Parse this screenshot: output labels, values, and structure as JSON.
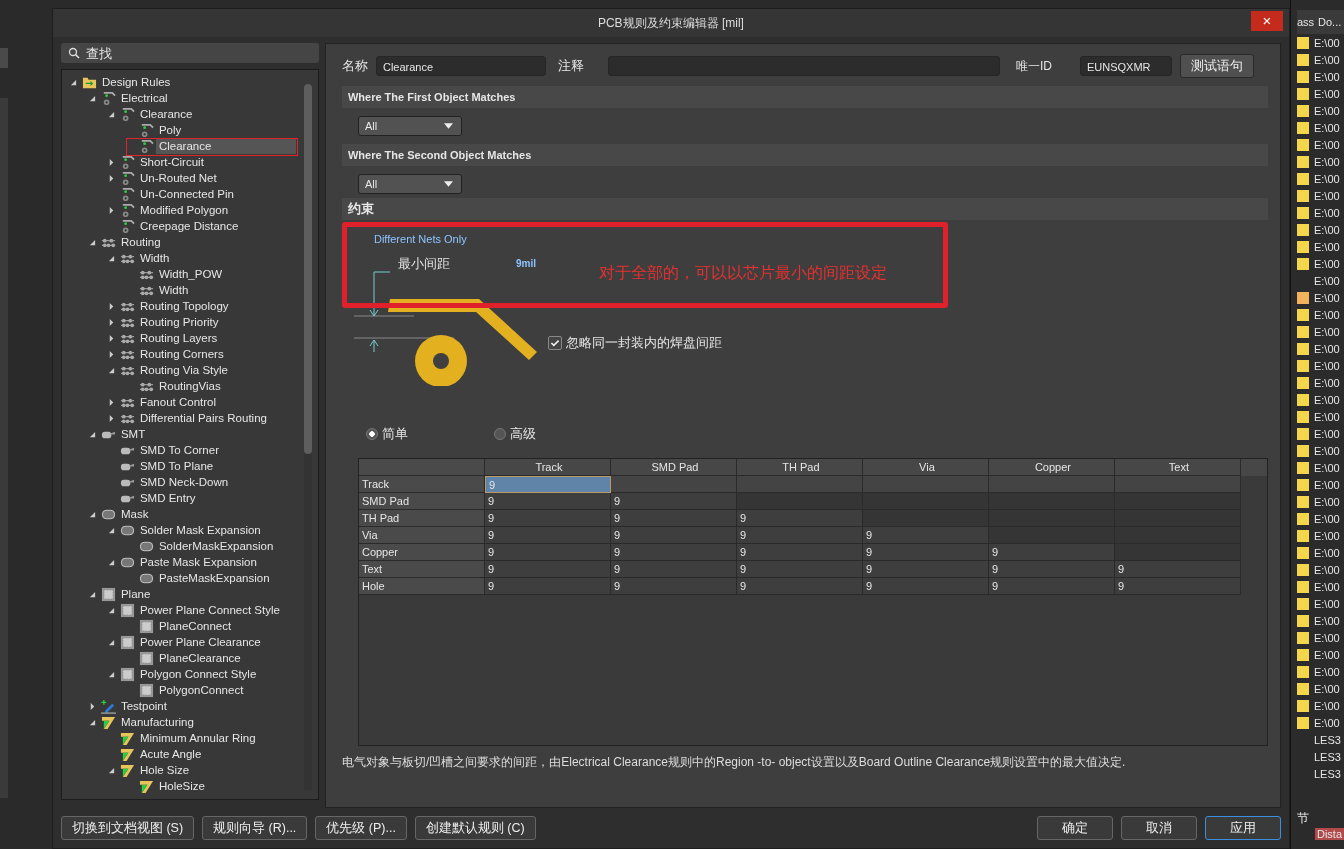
{
  "window": {
    "title": "PCB规则及约束编辑器 [mil]",
    "close": "×"
  },
  "search": {
    "placeholder": "查找"
  },
  "tree": [
    {
      "label": "Design Rules",
      "kind": "rules",
      "expanded": true,
      "selected": false,
      "children": [
        {
          "label": "Electrical",
          "kind": "electrical",
          "expanded": true,
          "selected": false,
          "children": [
            {
              "label": "Clearance",
              "kind": "electrical",
              "expanded": true,
              "selected": false,
              "children": [
                {
                  "label": "Poly",
                  "kind": "electrical",
                  "selected": false
                },
                {
                  "label": "Clearance",
                  "kind": "electrical",
                  "selected": true
                }
              ]
            },
            {
              "label": "Short-Circuit",
              "kind": "electrical",
              "expanded": false,
              "selected": false
            },
            {
              "label": "Un-Routed Net",
              "kind": "electrical",
              "expanded": false,
              "selected": false
            },
            {
              "label": "Un-Connected Pin",
              "kind": "electrical",
              "selected": false
            },
            {
              "label": "Modified Polygon",
              "kind": "electrical",
              "expanded": false,
              "selected": false
            },
            {
              "label": "Creepage Distance",
              "kind": "electrical",
              "selected": false
            }
          ]
        },
        {
          "label": "Routing",
          "kind": "routing",
          "expanded": true,
          "selected": false,
          "children": [
            {
              "label": "Width",
              "kind": "routing",
              "expanded": true,
              "selected": false,
              "children": [
                {
                  "label": "Width_POW",
                  "kind": "routing",
                  "selected": false
                },
                {
                  "label": "Width",
                  "kind": "routing",
                  "selected": false
                }
              ]
            },
            {
              "label": "Routing Topology",
              "kind": "routing",
              "expanded": false,
              "selected": false
            },
            {
              "label": "Routing Priority",
              "kind": "routing",
              "expanded": false,
              "selected": false
            },
            {
              "label": "Routing Layers",
              "kind": "routing",
              "expanded": false,
              "selected": false
            },
            {
              "label": "Routing Corners",
              "kind": "routing",
              "expanded": false,
              "selected": false
            },
            {
              "label": "Routing Via Style",
              "kind": "routing",
              "expanded": true,
              "selected": false,
              "children": [
                {
                  "label": "RoutingVias",
                  "kind": "routing",
                  "selected": false
                }
              ]
            },
            {
              "label": "Fanout Control",
              "kind": "routing",
              "expanded": false,
              "selected": false
            },
            {
              "label": "Differential Pairs Routing",
              "kind": "routing",
              "expanded": false,
              "selected": false
            }
          ]
        },
        {
          "label": "SMT",
          "kind": "smt",
          "expanded": true,
          "selected": false,
          "children": [
            {
              "label": "SMD To Corner",
              "kind": "smt",
              "selected": false
            },
            {
              "label": "SMD To Plane",
              "kind": "smt",
              "selected": false
            },
            {
              "label": "SMD Neck-Down",
              "kind": "smt",
              "selected": false
            },
            {
              "label": "SMD Entry",
              "kind": "smt",
              "selected": false
            }
          ]
        },
        {
          "label": "Mask",
          "kind": "mask",
          "expanded": true,
          "selected": false,
          "children": [
            {
              "label": "Solder Mask Expansion",
              "kind": "mask",
              "expanded": true,
              "selected": false,
              "children": [
                {
                  "label": "SolderMaskExpansion",
                  "kind": "mask",
                  "selected": false
                }
              ]
            },
            {
              "label": "Paste Mask Expansion",
              "kind": "mask",
              "expanded": true,
              "selected": false,
              "children": [
                {
                  "label": "PasteMaskExpansion",
                  "kind": "mask",
                  "selected": false
                }
              ]
            }
          ]
        },
        {
          "label": "Plane",
          "kind": "plane",
          "expanded": true,
          "selected": false,
          "children": [
            {
              "label": "Power Plane Connect Style",
              "kind": "plane",
              "expanded": true,
              "selected": false,
              "children": [
                {
                  "label": "PlaneConnect",
                  "kind": "plane",
                  "selected": false
                }
              ]
            },
            {
              "label": "Power Plane Clearance",
              "kind": "plane",
              "expanded": true,
              "selected": false,
              "children": [
                {
                  "label": "PlaneClearance",
                  "kind": "plane",
                  "selected": false
                }
              ]
            },
            {
              "label": "Polygon Connect Style",
              "kind": "plane",
              "expanded": true,
              "selected": false,
              "children": [
                {
                  "label": "PolygonConnect",
                  "kind": "plane",
                  "selected": false
                }
              ]
            }
          ]
        },
        {
          "label": "Testpoint",
          "kind": "testpoint",
          "expanded": false,
          "selected": false
        },
        {
          "label": "Manufacturing",
          "kind": "manufacturing",
          "expanded": true,
          "selected": false,
          "children": [
            {
              "label": "Minimum Annular Ring",
              "kind": "manufacturing",
              "selected": false
            },
            {
              "label": "Acute Angle",
              "kind": "manufacturing",
              "selected": false
            },
            {
              "label": "Hole Size",
              "kind": "manufacturing",
              "expanded": true,
              "selected": false,
              "children": [
                {
                  "label": "HoleSize",
                  "kind": "manufacturing",
                  "selected": false
                }
              ]
            }
          ]
        }
      ]
    }
  ],
  "rule": {
    "name_label": "名称",
    "name": "Clearance",
    "comment_label": "注释",
    "id_label": "唯一ID",
    "id": "EUNSQXMR",
    "test_button": "测试语句"
  },
  "first_match": {
    "title": "Where The First Object Matches",
    "value": "All"
  },
  "second_match": {
    "title": "Where The Second Object Matches",
    "value": "All"
  },
  "constraints": {
    "title": "约束",
    "scope": "Different Nets Only",
    "min_label": "最小间距",
    "min_value": "9mil",
    "annotation": "对于全部的，可以以芯片最小的间距设定",
    "ignore_pads": {
      "label": "忽略同一封装内的焊盘间距",
      "checked": true
    },
    "modes": [
      {
        "label": "简单",
        "selected": true
      },
      {
        "label": "高级",
        "selected": false
      }
    ]
  },
  "table": {
    "columns": [
      "Track",
      "SMD Pad",
      "TH Pad",
      "Via",
      "Copper",
      "Text"
    ],
    "rows": [
      {
        "label": "Track",
        "cells": [
          {
            "value": "9",
            "selected": true
          }
        ]
      },
      {
        "label": "SMD Pad",
        "cells": [
          {
            "value": "9",
            "selected": false
          },
          {
            "value": "9",
            "selected": false
          }
        ]
      },
      {
        "label": "TH Pad",
        "cells": [
          {
            "value": "9",
            "selected": false
          },
          {
            "value": "9",
            "selected": false
          },
          {
            "value": "9",
            "selected": false
          }
        ]
      },
      {
        "label": "Via",
        "cells": [
          {
            "value": "9",
            "selected": false
          },
          {
            "value": "9",
            "selected": false
          },
          {
            "value": "9",
            "selected": false
          },
          {
            "value": "9",
            "selected": false
          }
        ]
      },
      {
        "label": "Copper",
        "cells": [
          {
            "value": "9",
            "selected": false
          },
          {
            "value": "9",
            "selected": false
          },
          {
            "value": "9",
            "selected": false
          },
          {
            "value": "9",
            "selected": false
          },
          {
            "value": "9",
            "selected": false
          }
        ]
      },
      {
        "label": "Text",
        "cells": [
          {
            "value": "9",
            "selected": false
          },
          {
            "value": "9",
            "selected": false
          },
          {
            "value": "9",
            "selected": false
          },
          {
            "value": "9",
            "selected": false
          },
          {
            "value": "9",
            "selected": false
          },
          {
            "value": "9",
            "selected": false
          }
        ]
      },
      {
        "label": "Hole",
        "cells": [
          {
            "value": "9",
            "selected": false
          },
          {
            "value": "9",
            "selected": false
          },
          {
            "value": "9",
            "selected": false
          },
          {
            "value": "9",
            "selected": false
          },
          {
            "value": "9",
            "selected": false
          },
          {
            "value": "9",
            "selected": false
          }
        ]
      }
    ]
  },
  "note": "电气对象与板切/凹槽之间要求的间距，由Electrical Clearance规则中的Region -to- object设置以及Board Outline Clearance规则设置中的最大值决定.",
  "left_buttons": [
    "切换到文档视图 (S)",
    "规则向导 (R)...",
    "优先级 (P)...",
    "创建默认规则 (C)"
  ],
  "right_buttons": [
    {
      "label": "确定",
      "selected": false
    },
    {
      "label": "取消",
      "selected": false
    },
    {
      "label": "应用",
      "selected": true
    }
  ],
  "side_panel": {
    "columns": [
      "ass",
      "Do..."
    ],
    "rows": [
      {
        "text": "E:\\00",
        "color": "#f3d64c"
      },
      {
        "text": "E:\\00",
        "color": "#f3d64c"
      },
      {
        "text": "E:\\00",
        "color": "#f3d64c"
      },
      {
        "text": "E:\\00",
        "color": "#f3d64c"
      },
      {
        "text": "E:\\00",
        "color": "#f3d64c"
      },
      {
        "text": "E:\\00",
        "color": "#f3d64c"
      },
      {
        "text": "E:\\00",
        "color": "#f3d64c"
      },
      {
        "text": "E:\\00",
        "color": "#f3d64c"
      },
      {
        "text": "E:\\00",
        "color": "#f3d64c"
      },
      {
        "text": "E:\\00",
        "color": "#f3d64c"
      },
      {
        "text": "E:\\00",
        "color": "#f3d64c"
      },
      {
        "text": "E:\\00",
        "color": "#f3d64c"
      },
      {
        "text": "E:\\00",
        "color": "#f3d64c"
      },
      {
        "text": "E:\\00",
        "color": "#f3d64c"
      },
      {
        "text": "E:\\00"
      },
      {
        "text": "E:\\00",
        "color": "#f0b25a"
      },
      {
        "text": "E:\\00",
        "color": "#f3d64c"
      },
      {
        "text": "E:\\00",
        "color": "#f3d64c"
      },
      {
        "text": "E:\\00",
        "color": "#f3d64c"
      },
      {
        "text": "E:\\00",
        "color": "#f3d64c"
      },
      {
        "text": "E:\\00",
        "color": "#f3d64c"
      },
      {
        "text": "E:\\00",
        "color": "#f3d64c"
      },
      {
        "text": "E:\\00",
        "color": "#f3d64c"
      },
      {
        "text": "E:\\00",
        "color": "#f3d64c"
      },
      {
        "text": "E:\\00",
        "color": "#f3d64c"
      },
      {
        "text": "E:\\00",
        "color": "#f3d64c"
      },
      {
        "text": "E:\\00",
        "color": "#f3d64c"
      },
      {
        "text": "E:\\00",
        "color": "#f3d64c"
      },
      {
        "text": "E:\\00",
        "color": "#f3d64c"
      },
      {
        "text": "E:\\00",
        "color": "#f3d64c"
      },
      {
        "text": "E:\\00",
        "color": "#f3d64c"
      },
      {
        "text": "E:\\00",
        "color": "#f3d64c"
      },
      {
        "text": "E:\\00",
        "color": "#f3d64c"
      },
      {
        "text": "E:\\00",
        "color": "#f3d64c"
      },
      {
        "text": "E:\\00",
        "color": "#f3d64c"
      },
      {
        "text": "E:\\00",
        "color": "#f3d64c"
      },
      {
        "text": "E:\\00",
        "color": "#f3d64c"
      },
      {
        "text": "E:\\00",
        "color": "#f3d64c"
      },
      {
        "text": "E:\\00",
        "color": "#f3d64c"
      },
      {
        "text": "E:\\00",
        "color": "#f3d64c"
      },
      {
        "text": "E:\\00",
        "color": "#f3d64c"
      },
      {
        "text": "LES3"
      },
      {
        "text": "LES3"
      },
      {
        "text": "LES3"
      }
    ],
    "section": "节",
    "tag": "Dista"
  }
}
